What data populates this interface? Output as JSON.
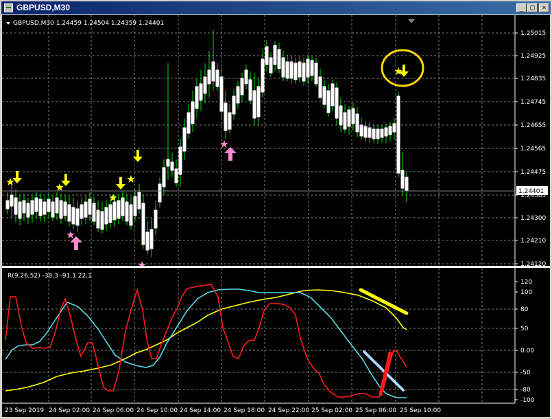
{
  "window": {
    "title": "GBPUSD,M30",
    "buttons": {
      "minimize": "_",
      "maximize": "□",
      "close": "×"
    }
  },
  "chart": {
    "header": "GBPUSD,M30  1.24459 1.24504 1.24359 1.24401",
    "current_price_label": "1.24401",
    "colors": {
      "background": "#000000",
      "bull": "#00ff00",
      "bear": "#ffffff",
      "grid": "#808080",
      "arrow_down": "#ffff00",
      "arrow_up": "#ff88cc",
      "highlight_circle": "#ffd800"
    }
  },
  "price_axis": [
    "1.25015",
    "1.24925",
    "1.24835",
    "1.24745",
    "1.24655",
    "1.24565",
    "1.24475",
    "1.24385",
    "1.24300",
    "1.24210",
    "1.24120"
  ],
  "indicator": {
    "header": "R(9,26,52) -38,3 -91.1 22.1",
    "axis": [
      "120",
      "100",
      "80",
      "50",
      "0.00",
      "-50",
      "-80",
      "-100"
    ]
  },
  "time_axis": [
    "23 Sep 2019",
    "24 Sep 02:00",
    "24 Sep 06:00",
    "24 Sep 10:00",
    "24 Sep 14:00",
    "24 Sep 18:00",
    "24 Sep 22:00",
    "25 Sep 02:00",
    "25 Sep 06:00",
    "25 Sep 10:00"
  ],
  "chart_data": {
    "type": "candlestick",
    "symbol": "GBPUSD",
    "timeframe": "M30",
    "ohlc_current": {
      "open": 1.24459,
      "high": 1.24504,
      "low": 1.24359,
      "close": 1.24401
    },
    "price_range": [
      1.2412,
      1.2505
    ],
    "indicator_name": "R(9,26,52)",
    "indicator_values": [
      -38.3,
      -91.1,
      22.1
    ],
    "indicator_range": [
      -100,
      120
    ]
  }
}
